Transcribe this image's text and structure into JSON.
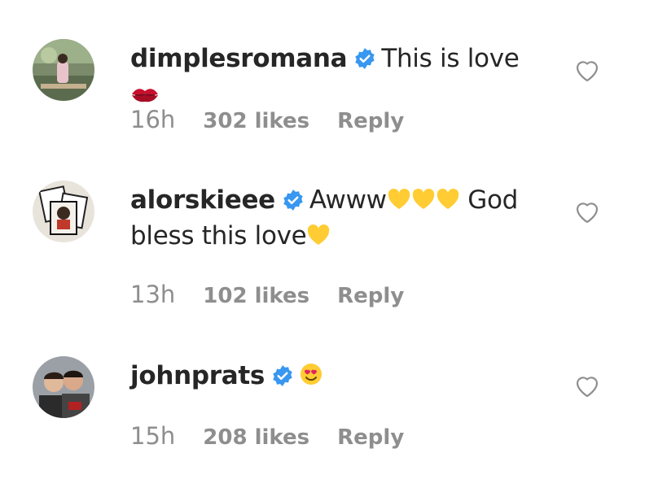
{
  "comments": [
    {
      "username": "dimplesromana",
      "text": "This is love",
      "emoji": "kiss-mark",
      "time": "16h",
      "likes": "302 likes",
      "reply": "Reply"
    },
    {
      "username": "alorskieee",
      "text_part1": "Awww",
      "text_part2": "God",
      "text_line2": "bless this love",
      "emoji": "yellow-heart",
      "time": "13h",
      "likes": "102 likes",
      "reply": "Reply"
    },
    {
      "username": "johnprats",
      "emoji": "heart-eyes",
      "time": "15h",
      "likes": "208 likes",
      "reply": "Reply"
    }
  ],
  "colors": {
    "verified": "#3897f0",
    "meta_text": "#8e8e8e",
    "primary_text": "#262626",
    "yellow_heart": "#ffcc33"
  }
}
